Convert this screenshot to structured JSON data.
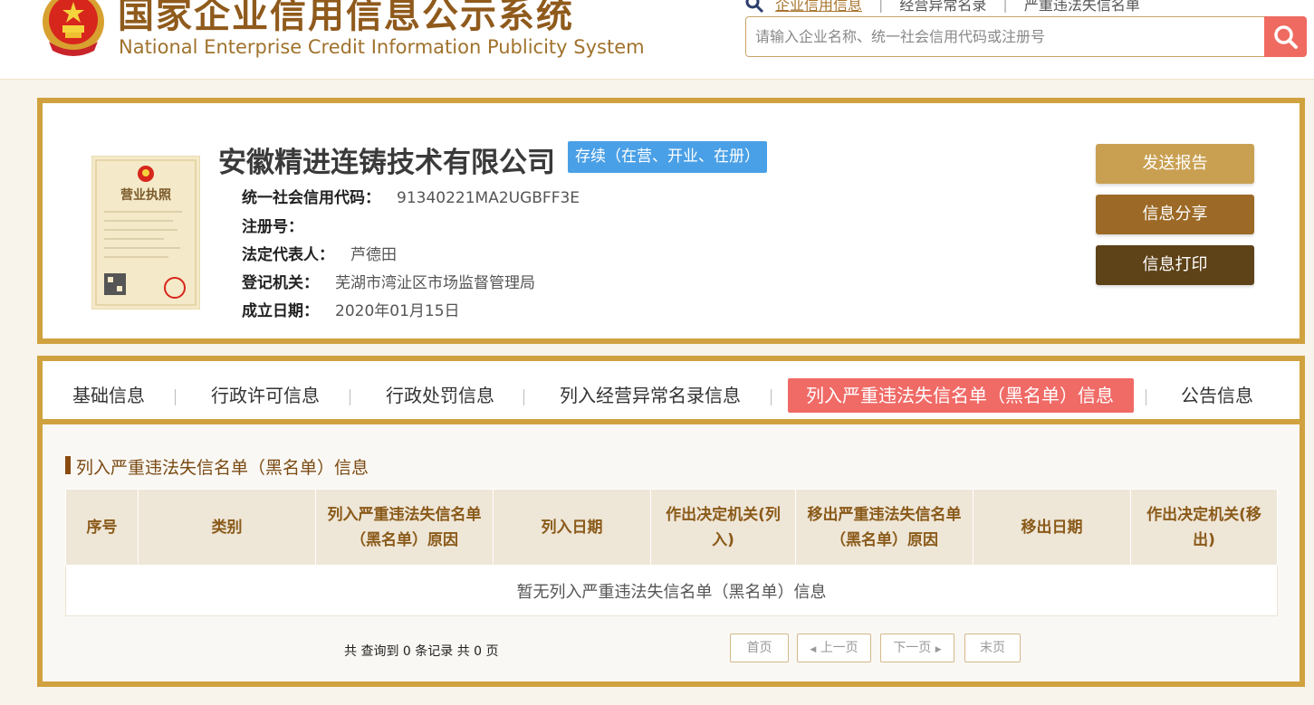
{
  "header": {
    "title_cn": "国家企业信用信息公示系统",
    "title_en": "National Enterprise Credit Information Publicity System",
    "links": [
      "企业信用信息",
      "经营异常名录",
      "严重违法失信名单"
    ],
    "search_placeholder": "请输入企业名称、统一社会信用代码或注册号",
    "search_icon": "search-icon"
  },
  "company": {
    "name": "安徽精进连铸技术有限公司",
    "status": "存续（在营、开业、在册）",
    "license_label": "营业执照",
    "fields": [
      {
        "label": "统一社会信用代码：",
        "value": "91340221MA2UGBFF3E"
      },
      {
        "label": "注册号：",
        "value": ""
      },
      {
        "label": "法定代表人：",
        "value": "芦德田"
      },
      {
        "label": "登记机关：",
        "value": "芜湖市湾沚区市场监督管理局"
      },
      {
        "label": "成立日期：",
        "value": "2020年01月15日"
      }
    ],
    "actions": [
      "发送报告",
      "信息分享",
      "信息打印"
    ]
  },
  "tabs": [
    {
      "label": "基础信息"
    },
    {
      "label": "行政许可信息"
    },
    {
      "label": "行政处罚信息"
    },
    {
      "label": "列入经营异常名录信息"
    },
    {
      "label": "列入严重违法失信名单（黑名单）信息"
    },
    {
      "label": "公告信息"
    }
  ],
  "section": {
    "title": "列入严重违法失信名单（黑名单）信息",
    "columns": [
      "序号",
      "类别",
      "列入严重违法失信名单（黑名单）原因",
      "列入日期",
      "作出决定机关(列入)",
      "移出严重违法失信名单（黑名单）原因",
      "移出日期",
      "作出决定机关(移出)"
    ],
    "empty_message": "暂无列入严重违法失信名单（黑名单）信息",
    "record_count": "共 查询到 0 条记录 共 0 页"
  },
  "pager": {
    "first": "首页",
    "prev": "上一页",
    "next": "下一页",
    "last": "末页"
  },
  "colors": {
    "brand_gold": "#d0a23f",
    "tab_active": "#f06a66",
    "status_blue": "#4aa0e6",
    "btn_send": "#c9a052",
    "btn_share": "#9c6a26",
    "btn_print": "#5e4218"
  }
}
